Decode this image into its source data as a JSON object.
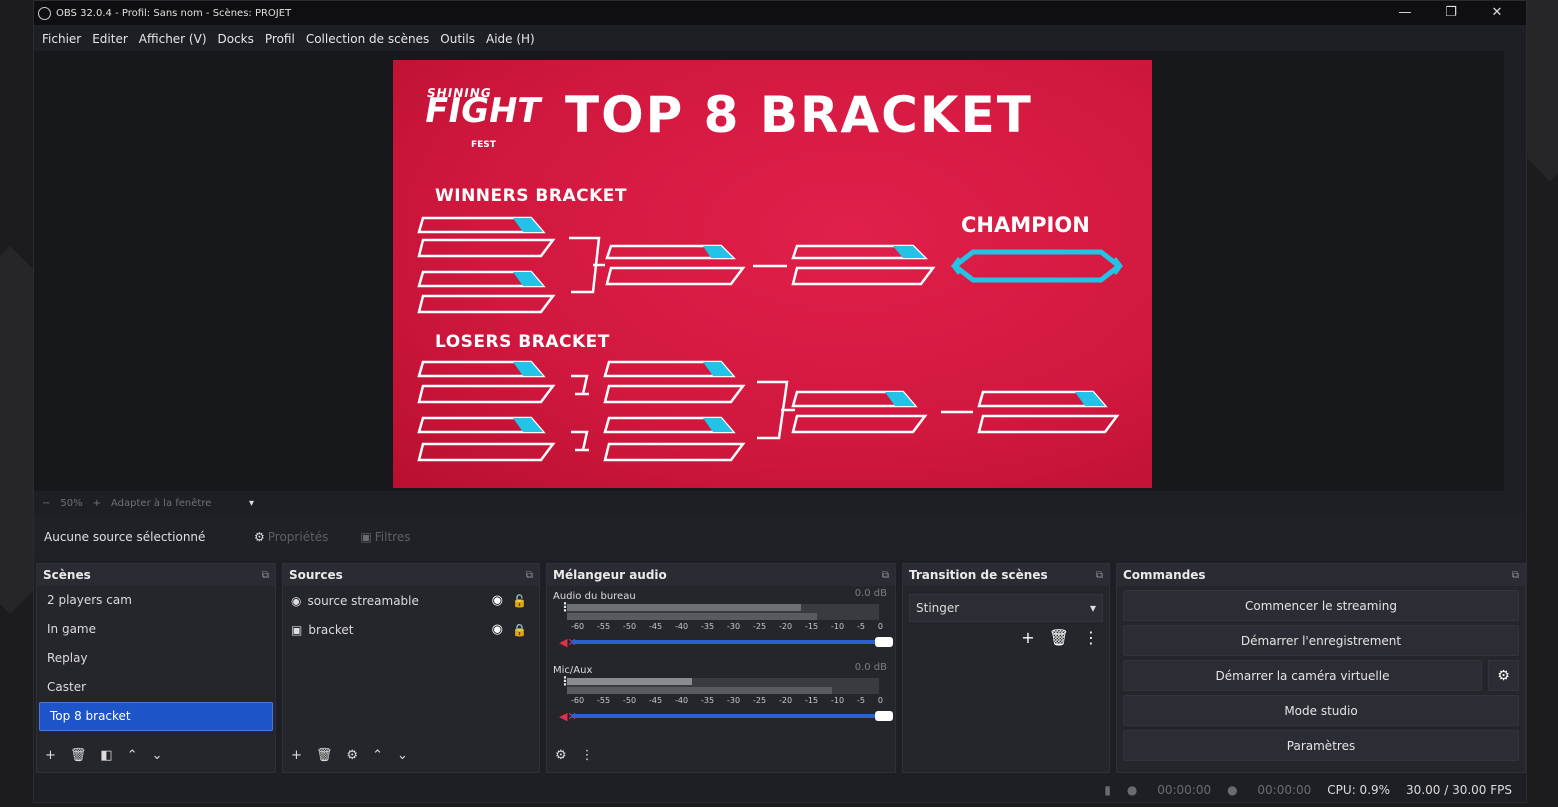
{
  "window": {
    "title": "OBS 32.0.4 - Profil: Sans nom - Scènes: PROJET",
    "minimize": "—",
    "maximize": "❐",
    "close": "✕"
  },
  "menu": [
    "Fichier",
    "Editer",
    "Afficher (V)",
    "Docks",
    "Profil",
    "Collection de scènes",
    "Outils",
    "Aide (H)"
  ],
  "preview": {
    "logo_small": "SHINING",
    "logo_big": "FIGHT",
    "logo_fest": "FEST",
    "title": "TOP 8 BRACKET",
    "winners_label": "WINNERS BRACKET",
    "losers_label": "LOSERS BRACKET",
    "champion_label": "CHAMPION",
    "accent": "#22c3e6",
    "background": "#d91a43"
  },
  "zoom": {
    "minus": "−",
    "value": "50%",
    "plus": "+",
    "fit": "Adapter à la fenêtre",
    "arrow": "▾"
  },
  "propbar": {
    "no_source": "Aucune source sélectionné",
    "properties": "Propriétés",
    "filters": "Filtres"
  },
  "scenes": {
    "title": "Scènes",
    "items": [
      "2 players cam",
      "In game",
      "Replay",
      "Caster",
      "Top 8 bracket"
    ],
    "selected_index": 4,
    "toolbar": [
      "+",
      "🗑",
      "◧",
      "⌃",
      "⌄"
    ]
  },
  "sources": {
    "title": "Sources",
    "items": [
      {
        "name": "source streamable",
        "icon": "globe-icon",
        "visible": true,
        "locked": false
      },
      {
        "name": "bracket",
        "icon": "image-icon",
        "visible": true,
        "locked": true
      }
    ],
    "toolbar": [
      "+",
      "🗑",
      "⚙",
      "⌃",
      "⌄"
    ]
  },
  "mixer": {
    "title": "Mélangeur audio",
    "channels": [
      {
        "name": "Audio du bureau",
        "db": "0.0 dB",
        "level": 0.9
      },
      {
        "name": "Mic/Aux",
        "db": "0.0 dB",
        "level": 0.9
      }
    ],
    "scale": [
      "-60",
      "-55",
      "-50",
      "-45",
      "-40",
      "-35",
      "-30",
      "-25",
      "-20",
      "-15",
      "-10",
      "-5",
      "0"
    ]
  },
  "transitions": {
    "title": "Transition de scènes",
    "selected": "Stinger"
  },
  "controls": {
    "title": "Commandes",
    "start_streaming": "Commencer le streaming",
    "start_recording": "Démarrer l'enregistrement",
    "start_virtualcam": "Démarrer la caméra virtuelle",
    "studio_mode": "Mode studio",
    "settings": "Paramètres"
  },
  "status": {
    "stream_time": "00:00:00",
    "record_time": "00:00:00",
    "cpu": "CPU: 0.9%",
    "fps": "30.00 / 30.00 FPS"
  }
}
